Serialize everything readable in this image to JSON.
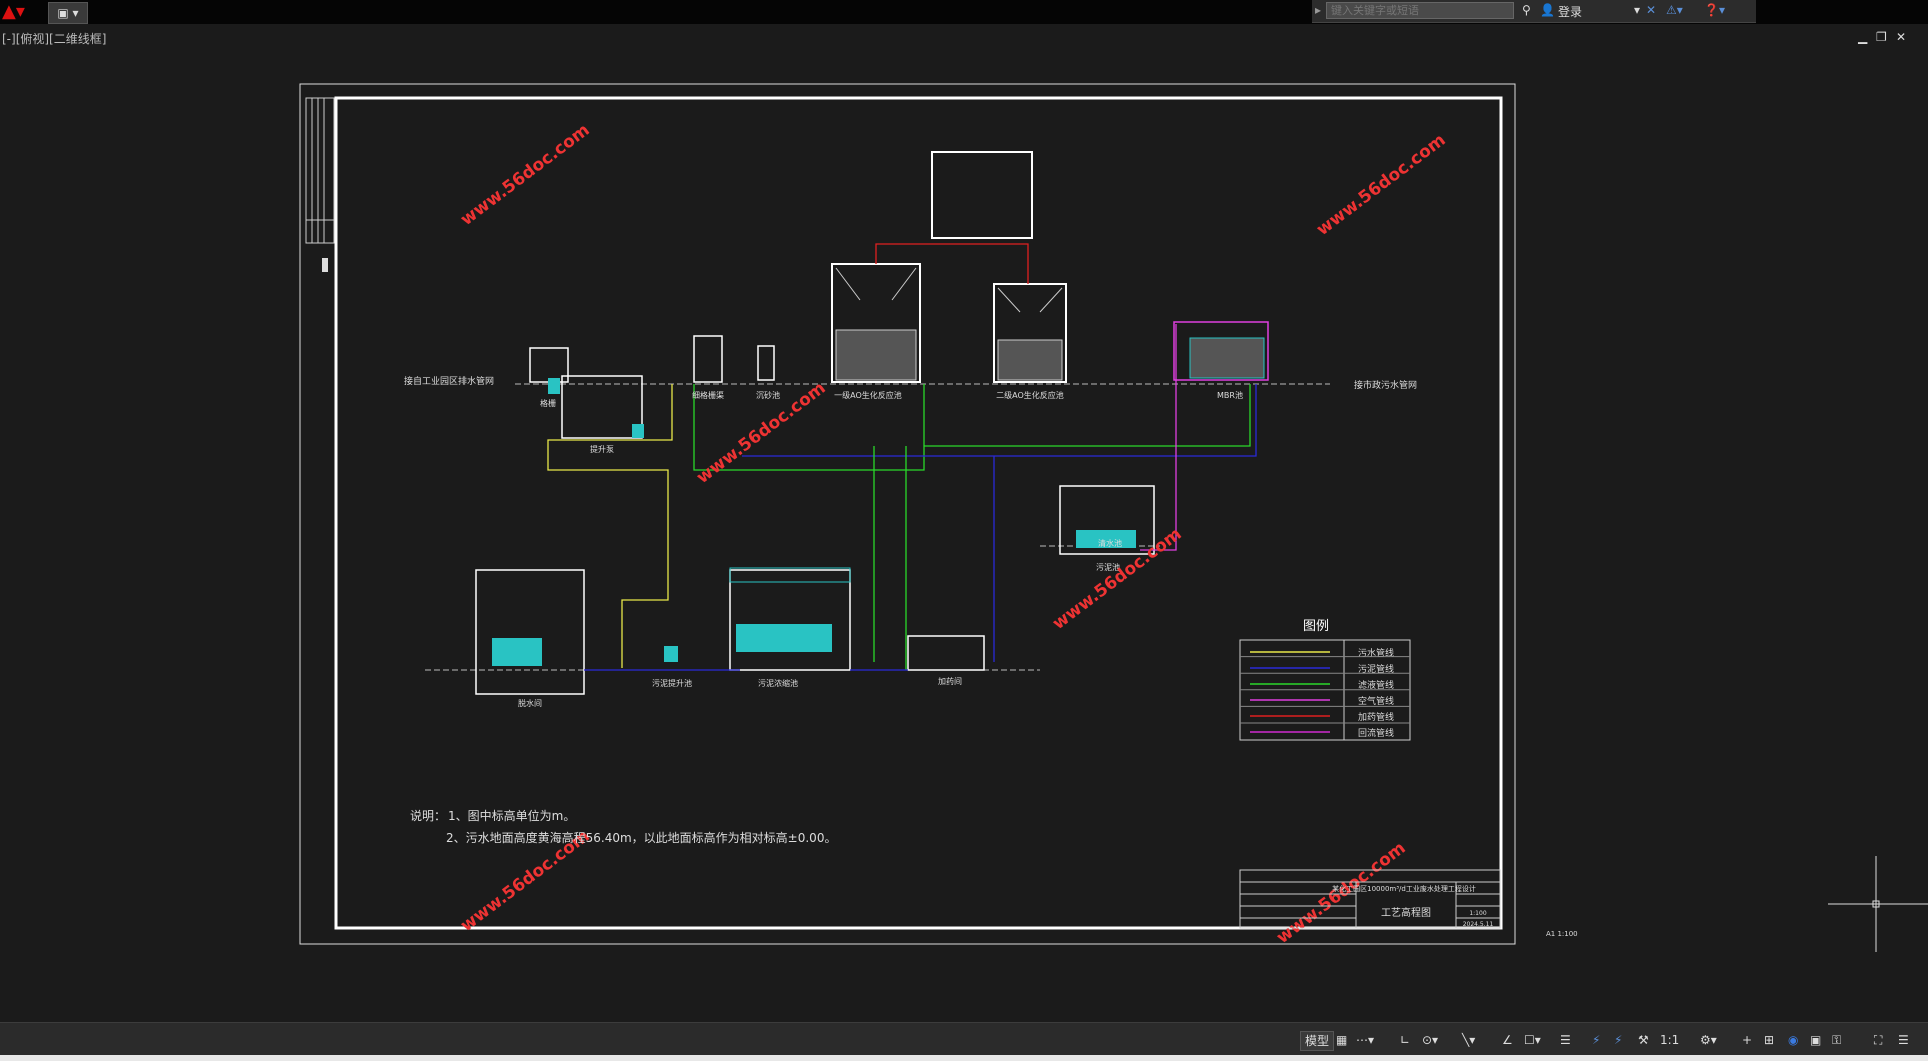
{
  "app": {
    "menu_icon": "autocad-logo-icon",
    "qa_icon": "quick-access-icon"
  },
  "search": {
    "placeholder": "键入关键字或短语",
    "login_label": "登录"
  },
  "viewport": {
    "label": "[-][俯视][二维线框]"
  },
  "drawing": {
    "left_inlet_label": "接自工业园区排水管网",
    "right_outlet_label": "接市政污水管网",
    "unit_labels": [
      "格栅",
      "提升泵",
      "细格栅渠",
      "沉砂池",
      "一级AO生化反应池",
      "二级AO生化反应池",
      "MBR池",
      "污泥池",
      "脱水间",
      "污泥提升池",
      "污泥浓缩池",
      "加药间",
      "清水池"
    ],
    "note_title": "说明：",
    "note_1": "1、图中标高单位为m。",
    "note_2": "2、污水地面高度黄海高程56.40m，以此地面标高作为相对标高±0.00。",
    "legend_title": "图例",
    "legend_items": [
      {
        "label": "污水管线",
        "color": "#e8e84a"
      },
      {
        "label": "污泥管线",
        "color": "#2a2ad8"
      },
      {
        "label": "滤液管线",
        "color": "#2ad82a"
      },
      {
        "label": "空气管线",
        "color": "#e040e0"
      },
      {
        "label": "加药管线",
        "color": "#e02020"
      },
      {
        "label": "回流管线",
        "color": "#d02ad0"
      }
    ],
    "title_block_drawing_name": "工艺高程图",
    "title_block_project": "某化工园区10000m³/d工业废水处理工程设计",
    "title_block_scale": "1:100",
    "title_block_date": "2024.5.11",
    "sheet_ref": "A1  1:100",
    "watermark": "www.56doc.com"
  },
  "status": {
    "model_tab": "模型",
    "scale": "1:1",
    "icons": [
      "grid-icon",
      "snap-icon",
      "ortho-icon",
      "polar-icon",
      "osnap-icon",
      "otrack-icon",
      "lineweight-icon",
      "transparency-icon",
      "annotation-icon",
      "workspace-icon",
      "plus-icon",
      "isolate-icon",
      "hardware-icon",
      "clean-screen-icon",
      "customize-icon"
    ]
  }
}
